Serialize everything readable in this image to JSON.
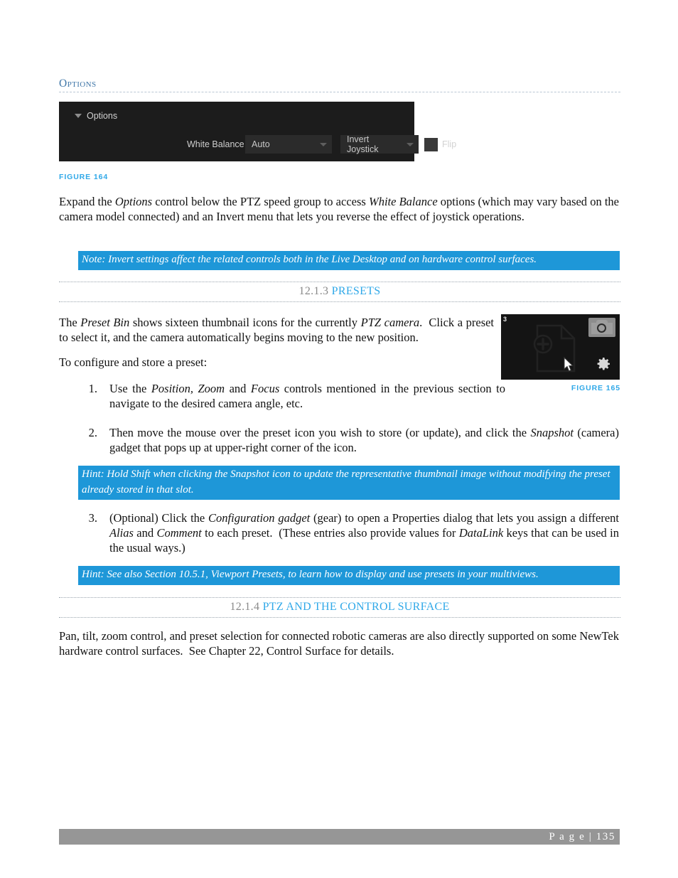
{
  "document": {
    "subheading": "Options",
    "footer_page_label": "P a g e  | 135"
  },
  "options_panel": {
    "header_label": "Options",
    "white_balance_label": "White Balance",
    "white_balance_value": "Auto",
    "invert_value": "Invert Joystick",
    "flip_label": "Flip",
    "panel_bg": "#1c1c1c",
    "dropdown_bg": "#2b2b2b"
  },
  "figures": {
    "figure_164_caption": "FIGURE 164",
    "figure_165_caption": "FIGURE 165",
    "preset_tile": {
      "badge": "3",
      "snapshot_gadget_name": "camera-snapshot-icon",
      "config_gadget_name": "gear-configuration-icon"
    }
  },
  "paragraphs": {
    "expand_options": "Expand the <i>Options</i> control below the PTZ speed group to access <i>White Balance</i> options (which may vary based on the camera model connected) and an Invert menu that lets you reverse the effect of joystick operations.",
    "preset_bin": "The <i>Preset Bin</i> shows sixteen thumbnail icons for the currently <i>PTZ camera</i>.&nbsp; Click a preset to select it, and the camera automatically begins moving to the new position.",
    "configure_store": "To configure and store a preset:",
    "pan_tilt": "Pan, tilt, zoom control, and preset selection for connected robotic cameras are also directly supported on some NewTek hardware control surfaces.&nbsp; See Chapter 22, Control Surface for details."
  },
  "notes": {
    "invert_note": "Note: Invert settings affect the related controls both in the Live Desktop and on hardware control surfaces.",
    "shift_hint": "Hint: Hold Shift when clicking the Snapshot icon to update the representative thumbnail image without modifying the preset already stored in that slot.",
    "viewport_hint": "Hint: See also Section 10.5.1, Viewport Presets, to learn how to display and use presets in your multiviews."
  },
  "sections": [
    {
      "number": "12.1.3",
      "title": "PRESETS"
    },
    {
      "number": "12.1.4",
      "title": "PTZ AND THE CONTROL SURFACE"
    }
  ],
  "steps": [
    {
      "num": "1.",
      "text": "Use the <i>Position, Zoom</i> and <i>Focus</i> controls mentioned in the previous section to navigate to the desired camera angle, etc."
    },
    {
      "num": "2.",
      "text": "Then move the mouse over the preset icon you wish to store (or update), and click the <i>Snapshot</i> (camera) gadget that pops up at upper-right corner of the icon."
    },
    {
      "num": "3.",
      "text": "(Optional) Click the <i>Configuration gadget</i> (gear) to open a Properties dialog that lets you assign a different <i>Alias</i> and <i>Comment</i> to each preset.&nbsp; (These entries also provide values for <i>DataLink</i> keys that can be used in the usual ways.)"
    }
  ],
  "colors": {
    "accent_blue": "#2fa8e8",
    "note_blue": "#1e97d8",
    "heading_blue": "#3f76a8",
    "footer_gray": "#969696"
  }
}
